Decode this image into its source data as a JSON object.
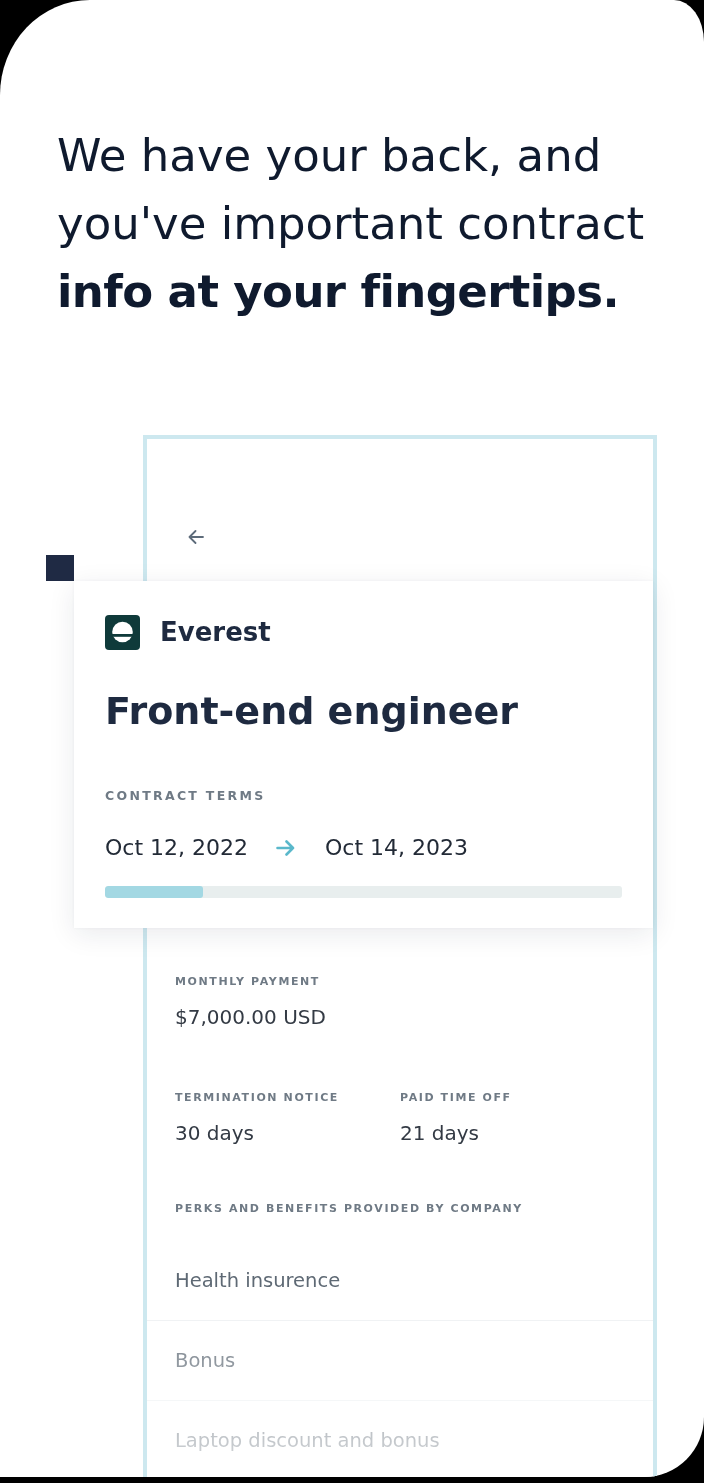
{
  "headline": "We have your back, and you've important contract **info at your fingertips.**",
  "app_preview": {
    "company": "Everest",
    "job_title": "Front-end engineer",
    "contract_terms": {
      "label": "CONTRACT TERMS",
      "start_date": "Oct 12, 2022",
      "end_date": "Oct 14, 2023",
      "level": 0.19
    },
    "detail_rows": [
      {
        "fields": [
          {
            "label": "MONTHLY PAYMENT",
            "value": "$7,000.00 USD"
          }
        ]
      },
      {
        "fields": [
          {
            "label": "TERMINATION NOTICE",
            "value": "30 days"
          },
          {
            "label": "PAID TIME OFF",
            "value": "21 days"
          }
        ]
      }
    ],
    "perks": {
      "label": "PERKS AND BENEFITS PROVIDED BY COMPANY",
      "items": [
        "Health insurence",
        "Bonus",
        "Laptop discount and bonus"
      ]
    }
  }
}
